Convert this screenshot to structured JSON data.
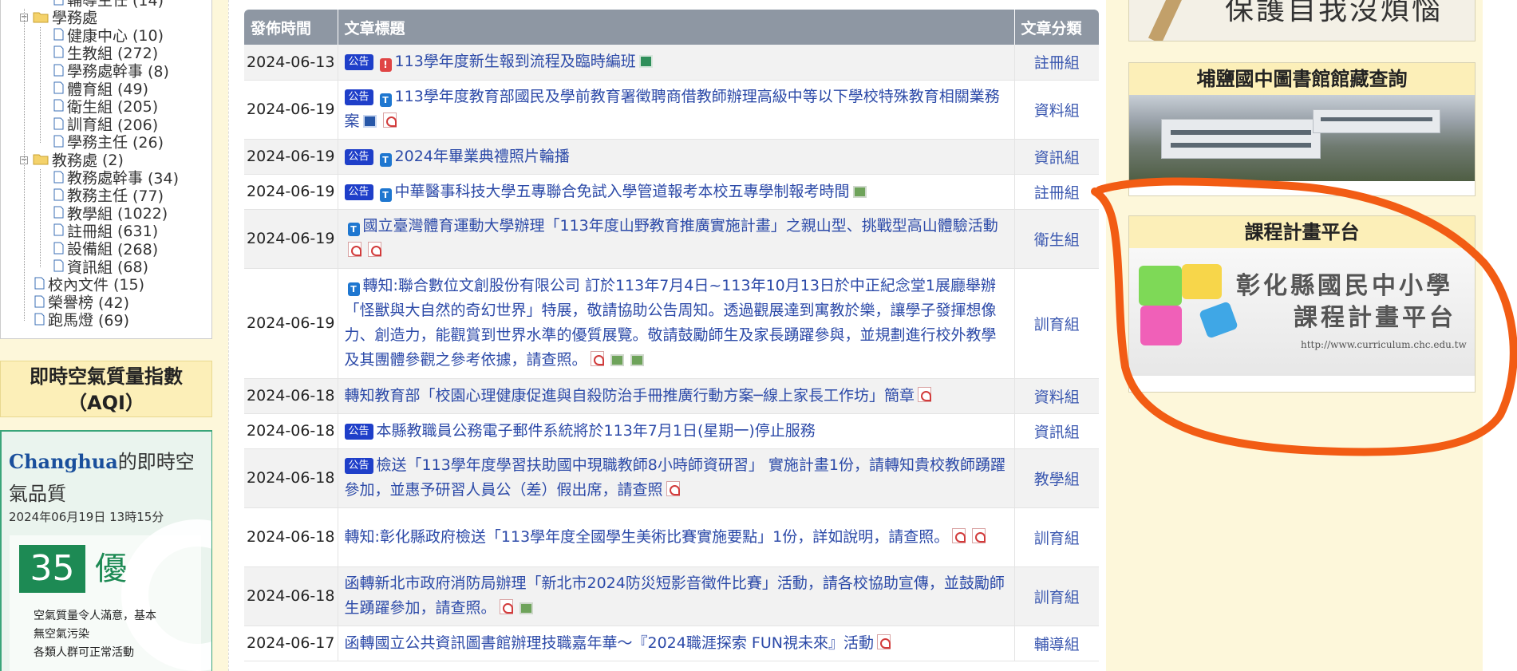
{
  "tree": {
    "top_partial": {
      "label": "輔導主任",
      "count": "(14)"
    },
    "groups": [
      {
        "name": "學務處",
        "children": [
          {
            "label": "健康中心",
            "count": "(10)"
          },
          {
            "label": "生教組",
            "count": "(272)"
          },
          {
            "label": "學務處幹事",
            "count": "(8)"
          },
          {
            "label": "體育組",
            "count": "(49)"
          },
          {
            "label": "衛生組",
            "count": "(205)"
          },
          {
            "label": "訓育組",
            "count": "(206)"
          },
          {
            "label": "學務主任",
            "count": "(26)"
          }
        ]
      },
      {
        "name": "教務處",
        "count": "(2)",
        "children": [
          {
            "label": "教務處幹事",
            "count": "(34)"
          },
          {
            "label": "教務主任",
            "count": "(77)"
          },
          {
            "label": "教學組",
            "count": "(1022)"
          },
          {
            "label": "註冊組",
            "count": "(631)"
          },
          {
            "label": "設備組",
            "count": "(268)"
          },
          {
            "label": "資訊組",
            "count": "(68)"
          }
        ]
      }
    ],
    "roots": [
      {
        "label": "校內文件",
        "count": "(15)"
      },
      {
        "label": "榮譽榜",
        "count": "(42)"
      },
      {
        "label": "跑馬燈",
        "count": "(69)"
      }
    ]
  },
  "aqi": {
    "title": "即時空氣質量指數（AQI）",
    "city": "Changhua",
    "headline_rest": "的即時空氣品質",
    "time": "2024年06月19日 13時15分",
    "value": "35",
    "level": "優",
    "desc": [
      "空氣質量令人滿意，基本",
      "無空氣污染",
      "各類人群可正常活動"
    ],
    "color": "#1d8a54"
  },
  "table": {
    "headers": {
      "date": "發佈時間",
      "title": "文章標題",
      "category": "文章分類"
    },
    "rows": [
      {
        "date": "2024-06-13",
        "badge": "公告",
        "pre": [
          "hot"
        ],
        "title": "113學年度新生報到流程及臨時編班",
        "post": [
          "xls"
        ],
        "category": "註冊組"
      },
      {
        "date": "2024-06-19",
        "badge": "公告",
        "pre": [
          "top"
        ],
        "title": "113學年度教育部國民及學前教育署徵聘商借教師辦理高級中等以下學校特殊教育相關業務案",
        "post": [
          "doc",
          "pdf"
        ],
        "category": "資料組"
      },
      {
        "date": "2024-06-19",
        "badge": "公告",
        "pre": [
          "top"
        ],
        "title": "2024年畢業典禮照片輪播",
        "post": [],
        "category": "資訊組"
      },
      {
        "date": "2024-06-19",
        "badge": "公告",
        "pre": [
          "top"
        ],
        "title": "中華醫事科技大學五專聯合免試入學管道報考本校五專學制報考時間",
        "post": [
          "img"
        ],
        "category": "註冊組"
      },
      {
        "date": "2024-06-19",
        "badge": "",
        "pre": [
          "top"
        ],
        "title": "國立臺灣體育運動大學辦理「113年度山野教育推廣實施計畫」之親山型、挑戰型高山體驗活動",
        "post": [
          "pdf",
          "pdf"
        ],
        "category": "衛生組"
      },
      {
        "date": "2024-06-19",
        "badge": "",
        "pre": [
          "top"
        ],
        "title": "轉知:聯合數位文創股份有限公司 訂於113年7月4日~113年10月13日於中正紀念堂1展廳舉辦「怪獸與大自然的奇幻世界」特展，敬請協助公告周知。透過觀展達到寓教於樂，讓學子發揮想像力、創造力，能觀賞到世界水準的優質展覽。敬請鼓勵師生及家長踴躍參與，並規劃進行校外教學及其團體參觀之參考依據，請查照。",
        "post": [
          "pdf",
          "img",
          "img"
        ],
        "category": "訓育組"
      },
      {
        "date": "2024-06-18",
        "badge": "",
        "pre": [],
        "title": "轉知教育部「校園心理健康促進與自殺防治手冊推廣行動方案─線上家長工作坊」簡章",
        "post": [
          "pdf"
        ],
        "category": "資料組"
      },
      {
        "date": "2024-06-18",
        "badge": "公告",
        "pre": [],
        "title": "本縣教職員公務電子郵件系統將於113年7月1日(星期一)停止服務",
        "post": [],
        "category": "資訊組"
      },
      {
        "date": "2024-06-18",
        "badge": "公告",
        "pre": [],
        "title": "檢送「113學年度學習扶助國中現職教師8小時師資研習」 實施計畫1份，請轉知貴校教師踴躍參加，並惠予研習人員公（差）假出席，請查照",
        "post": [
          "pdf"
        ],
        "category": "教學組"
      },
      {
        "date": "2024-06-18",
        "badge": "",
        "pre": [],
        "title": "轉知:彰化縣政府檢送「113學年度全國學生美術比賽實施要點」1份，詳如說明，請查照。",
        "post": [
          "pdf",
          "pdf"
        ],
        "category": "訓育組"
      },
      {
        "date": "2024-06-18",
        "badge": "",
        "pre": [],
        "title": "函轉新北市政府消防局辦理「新北市2024防災短影音徵件比賽」活動，請各校協助宣傳，並鼓勵師生踴躍參加，請查照。",
        "post": [
          "pdf",
          "img"
        ],
        "category": "訓育組"
      },
      {
        "date": "2024-06-17",
        "badge": "",
        "pre": [],
        "title": "函轉國立公共資訊圖書館辦理技職嘉年華～『2024職涯探索 FUN視未來』活動",
        "post": [
          "pdf"
        ],
        "category": "輔導組"
      }
    ]
  },
  "sidebar": {
    "top_banner_text": "保護自我沒煩惱",
    "library_title": "埔鹽國中圖書館館藏查詢",
    "curriculum_title": "課程計畫平台",
    "curriculum_line1": "彰化縣國民中小學",
    "curriculum_line2": "課程計畫平台",
    "curriculum_url": "http://www.curriculum.chc.edu.tw"
  },
  "colors": {
    "badge": "#1f3fc9",
    "header": "#8e97a3",
    "annotation": "#f25c14",
    "link": "#2c4aa8"
  }
}
